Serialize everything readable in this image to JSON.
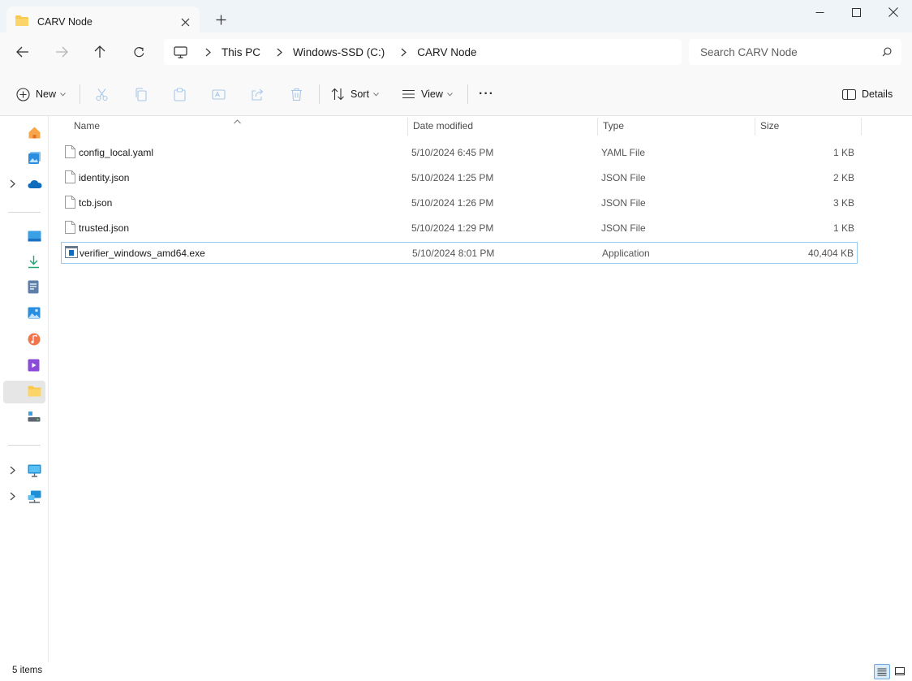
{
  "window": {
    "tab_title": "CARV Node",
    "tab_icon": "folder-icon",
    "new_tab": "+",
    "controls": [
      "minimize-icon",
      "maximize-icon",
      "close-icon"
    ]
  },
  "navigation": {
    "buttons": [
      "back-arrow-icon",
      "forward-arrow-icon",
      "up-arrow-icon",
      "refresh-icon"
    ],
    "breadcrumb": [
      "This PC",
      "Windows-SSD (C:)",
      "CARV Node"
    ],
    "search_placeholder": "Search CARV Node"
  },
  "toolbar": {
    "new_label": "New",
    "sort_label": "Sort",
    "view_label": "View",
    "more_label": "···",
    "details_label": "Details",
    "disabled_actions": [
      "cut-icon",
      "copy-icon",
      "paste-icon",
      "rename-icon",
      "share-icon",
      "delete-icon"
    ]
  },
  "sidebar": {
    "items": [
      "home-icon",
      "gallery-icon",
      "onedrive-icon",
      "desktop-icon",
      "downloads-icon",
      "documents-icon",
      "pictures-icon",
      "music-icon",
      "videos-icon",
      "folder-icon",
      "drive-icon",
      "this-pc-icon",
      "network-icon"
    ],
    "selected_icon": "folder-icon"
  },
  "file_list": {
    "columns": {
      "name": "Name",
      "date": "Date modified",
      "type": "Type",
      "size": "Size"
    },
    "sorted_by": "Name",
    "rows": [
      {
        "name": "config_local.yaml",
        "date": "5/10/2024 6:45 PM",
        "type": "YAML File",
        "size": "1 KB",
        "icon": "document-icon"
      },
      {
        "name": "identity.json",
        "date": "5/10/2024 1:25 PM",
        "type": "JSON File",
        "size": "2 KB",
        "icon": "document-icon"
      },
      {
        "name": "tcb.json",
        "date": "5/10/2024 1:26 PM",
        "type": "JSON File",
        "size": "3 KB",
        "icon": "document-icon"
      },
      {
        "name": "trusted.json",
        "date": "5/10/2024 1:29 PM",
        "type": "JSON File",
        "size": "1 KB",
        "icon": "document-icon"
      },
      {
        "name": "verifier_windows_amd64.exe",
        "date": "5/10/2024 8:01 PM",
        "type": "Application",
        "size": "40,404 KB",
        "icon": "application-icon",
        "selected": true
      }
    ]
  },
  "status": {
    "item_count": "5 items",
    "views": [
      "details-view-icon",
      "tiles-view-icon"
    ],
    "active_view": "details-view-icon"
  },
  "colors": {
    "accent": "#0067c0",
    "selection_border": "#99c9ef",
    "titlebar_bg": "#eff4f9",
    "toolbar_bg": "#f9f9f9",
    "folder_yellow": "#f8c94c"
  }
}
